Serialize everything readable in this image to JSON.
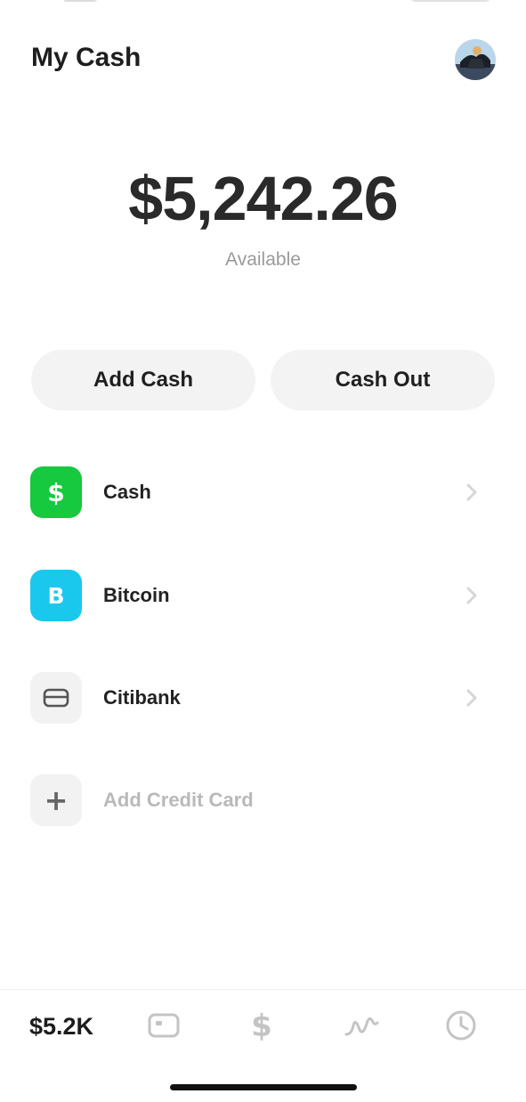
{
  "header": {
    "title": "My Cash"
  },
  "balance": {
    "amount": "$5,242.26",
    "label": "Available"
  },
  "actions": {
    "add_cash": "Add Cash",
    "cash_out": "Cash Out"
  },
  "accounts": [
    {
      "label": "Cash",
      "icon": "dollar-icon",
      "glyph": "$",
      "color": "#16c93f"
    },
    {
      "label": "Bitcoin",
      "icon": "bitcoin-icon",
      "glyph": "B",
      "color": "#1ac8ee"
    },
    {
      "label": "Citibank",
      "icon": "bank-card-icon"
    },
    {
      "label": "Add Credit Card",
      "icon": "plus-icon",
      "glyph": "+"
    }
  ],
  "tabbar": {
    "balance": "$5.2K",
    "tabs": [
      "card-icon",
      "dollar-icon",
      "investing-icon",
      "activity-clock-icon"
    ]
  },
  "colors": {
    "cash_green": "#16c93f",
    "bitcoin_blue": "#1ac8ee",
    "muted_text": "#9a9a9a"
  }
}
